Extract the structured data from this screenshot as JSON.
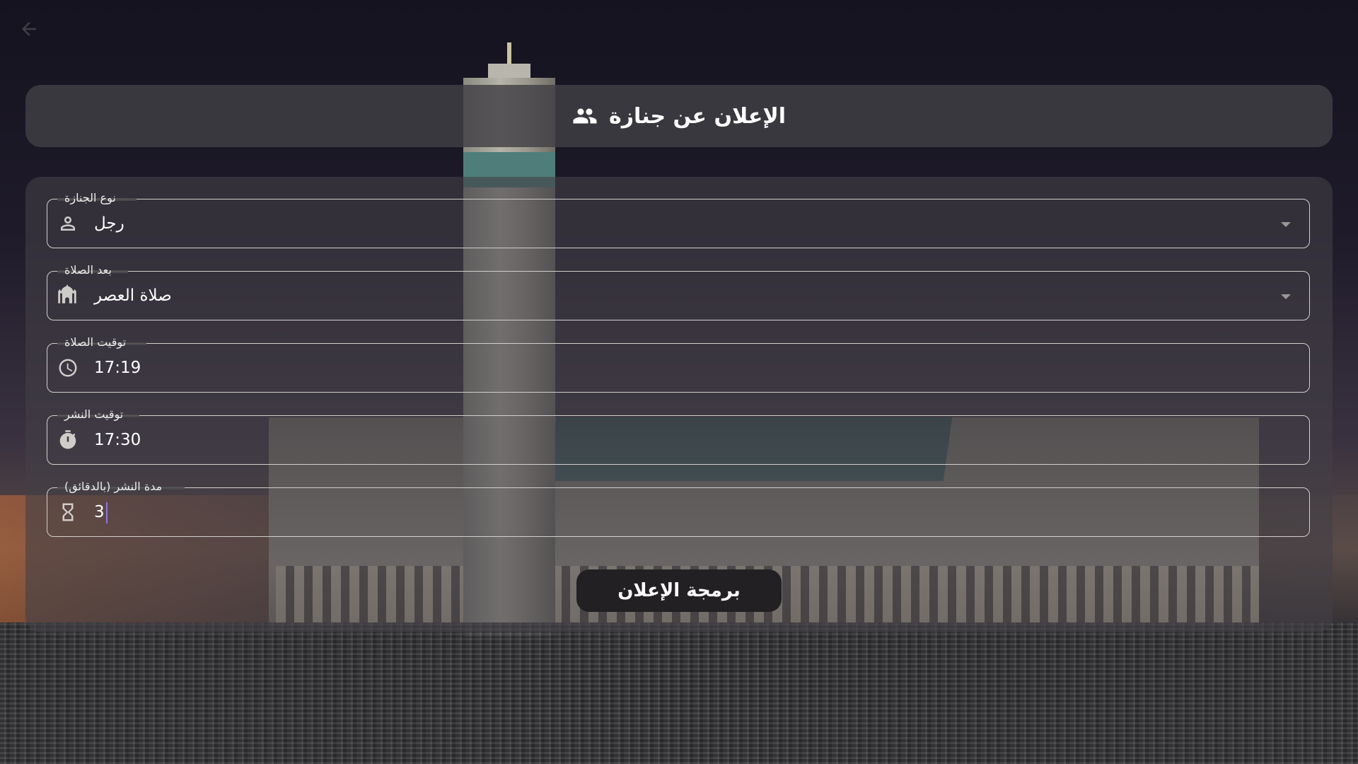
{
  "header": {
    "title": "الإعلان عن جنازة",
    "icon": "group-icon"
  },
  "form": {
    "fields": [
      {
        "label": "نوع الجنازة",
        "value": "رجل",
        "icon": "person-icon",
        "type": "dropdown"
      },
      {
        "label": "بعد الصلاة",
        "value": "صلاة العصر",
        "icon": "mosque-icon",
        "type": "dropdown"
      },
      {
        "label": "توقيت الصلاة",
        "value": "17:19",
        "icon": "clock-icon",
        "type": "time"
      },
      {
        "label": "توقيت النشر",
        "value": "17:30",
        "icon": "timer-icon",
        "type": "time"
      },
      {
        "label": "مدة النشر (بالدقائق)",
        "value": "3",
        "icon": "hourglass-icon",
        "type": "number"
      }
    ],
    "submit_label": "برمجة الإعلان"
  },
  "colors": {
    "card_bg": "#424046",
    "field_border": "#d2d0cc",
    "cursor": "#8c74e8",
    "button_bg": "#222023"
  }
}
